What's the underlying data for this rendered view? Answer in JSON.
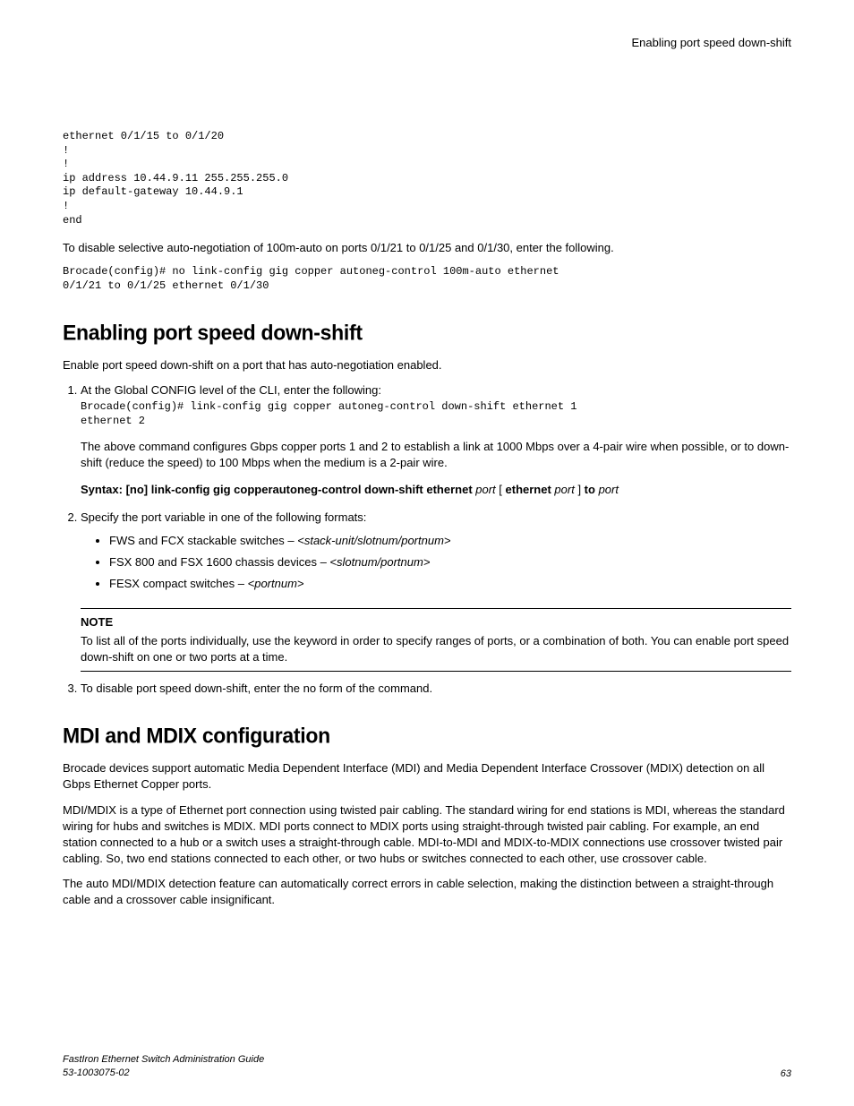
{
  "header": {
    "title": "Enabling port speed down-shift"
  },
  "intro": {
    "code1": "ethernet 0/1/15 to 0/1/20\n!\n!\nip address 10.44.9.11 255.255.255.0\nip default-gateway 10.44.9.1\n!\nend",
    "disable_text": "To disable selective auto-negotiation of 100m-auto on ports 0/1/21 to 0/1/25 and 0/1/30, enter the following.",
    "code2": "Brocade(config)# no link-config gig copper autoneg-control 100m-auto ethernet\n0/1/21 to 0/1/25 ethernet 0/1/30"
  },
  "section1": {
    "heading": "Enabling port speed down-shift",
    "intro": "Enable port speed down-shift on a port that has auto-negotiation enabled.",
    "step1": {
      "text": "At the Global CONFIG level of the CLI, enter the following:",
      "code": "Brocade(config)# link-config gig copper autoneg-control down-shift ethernet 1\nethernet 2",
      "para": "The above command configures Gbps copper ports 1 and 2 to establish a link at 1000 Mbps over a 4-pair wire when possible, or to down-shift (reduce the speed) to 100 Mbps when the medium is a 2-pair wire.",
      "syntax_prefix": "Syntax: [no] link-config gig copperautoneg-control down-shift ethernet ",
      "syntax_port": "port",
      "syntax_bracket_open": " [ ",
      "syntax_ethernet": "ethernet ",
      "syntax_port2": "port",
      "syntax_bracket_close": " ] ",
      "syntax_to": "to ",
      "syntax_port3": "port"
    },
    "step2": {
      "text": "Specify the port variable in one of the following formats:",
      "bullets": [
        {
          "prefix": "FWS and FCX stackable switches – ",
          "italic": "<stack-unit/slotnum/portnum>"
        },
        {
          "prefix": "FSX 800 and FSX 1600 chassis devices – ",
          "italic": "<slotnum/portnum>"
        },
        {
          "prefix": "FESX compact switches – ",
          "italic": "<portnum>"
        }
      ],
      "note_label": "NOTE",
      "note_text": "To list all of the ports individually, use the keyword in order to specify ranges of ports, or a combination of both. You can enable port speed down-shift on one or two ports at a time."
    },
    "step3": {
      "text": "To disable port speed down-shift, enter the no form of the command."
    }
  },
  "section2": {
    "heading": "MDI and MDIX configuration",
    "para1": "Brocade devices support automatic Media Dependent Interface (MDI) and Media Dependent Interface Crossover (MDIX) detection on all Gbps Ethernet Copper ports.",
    "para2": "MDI/MDIX is a type of Ethernet port connection using twisted pair cabling. The standard wiring for end stations is MDI, whereas the standard wiring for hubs and switches is MDIX. MDI ports connect to MDIX ports using straight-through twisted pair cabling. For example, an end station connected to a hub or a switch uses a straight-through cable. MDI-to-MDI and MDIX-to-MDIX connections use crossover twisted pair cabling. So, two end stations connected to each other, or two hubs or switches connected to each other, use crossover cable.",
    "para3": "The auto MDI/MDIX detection feature can automatically correct errors in cable selection, making the distinction between a straight-through cable and a crossover cable insignificant."
  },
  "footer": {
    "guide": "FastIron Ethernet Switch Administration Guide",
    "docnum": "53-1003075-02",
    "page": "63"
  }
}
